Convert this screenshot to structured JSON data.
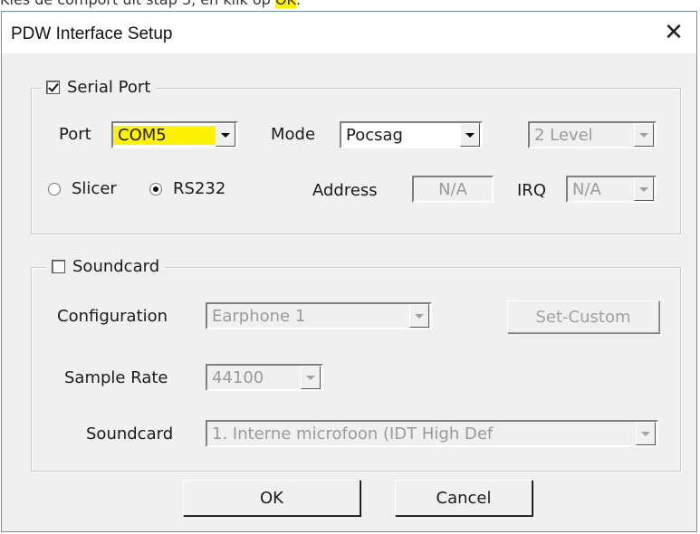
{
  "caption": {
    "prefix": "Kies de comport uit stap 3, en klik op ",
    "highlight": "OK",
    "suffix": "."
  },
  "dialog": {
    "title": "PDW Interface Setup",
    "close_symbol": "✕"
  },
  "serial_port": {
    "legend": "Serial Port",
    "checked": true,
    "port_label": "Port",
    "port_value": "COM5",
    "mode_label": "Mode",
    "mode_value": "Pocsag",
    "level_value": "2 Level",
    "slicer_label": "Slicer",
    "rs232_label": "RS232",
    "selected_interface": "RS232",
    "address_label": "Address",
    "address_value": "N/A",
    "irq_label": "IRQ",
    "irq_value": "N/A"
  },
  "soundcard": {
    "legend": "Soundcard",
    "checked": false,
    "configuration_label": "Configuration",
    "configuration_value": "Earphone 1",
    "set_custom_label": "Set-Custom",
    "sample_rate_label": "Sample Rate",
    "sample_rate_value": "44100",
    "soundcard_label": "Soundcard",
    "soundcard_value": "1. Interne microfoon (IDT High Def"
  },
  "buttons": {
    "ok": "OK",
    "cancel": "Cancel"
  },
  "colors": {
    "highlight": "#fff200",
    "dialog_bg": "#f0f0f0",
    "border_accent": "#6f8fb8"
  }
}
